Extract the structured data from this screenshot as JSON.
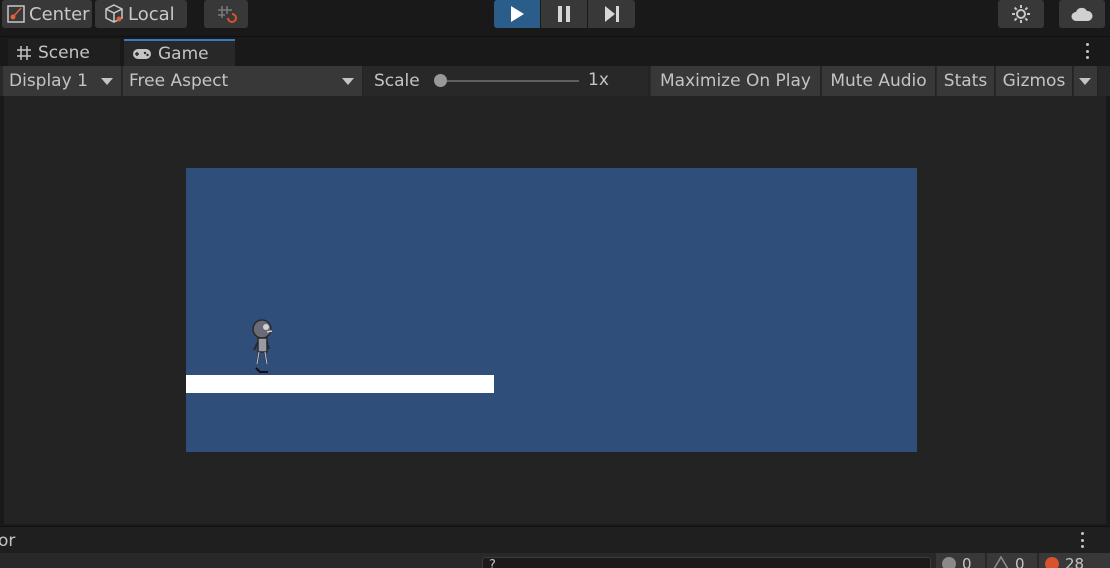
{
  "toolbar": {
    "pivot_label": "Center",
    "space_label": "Local",
    "icons": [
      "center-pivot-icon",
      "local-cube-icon",
      "grid-snap-icon",
      "play-icon",
      "pause-icon",
      "step-icon",
      "settings-sun-icon",
      "cloud-icon"
    ],
    "play_color": "#2b5d8a"
  },
  "tabs": [
    {
      "label": "Scene",
      "icon": "grid-hash-icon",
      "active": false
    },
    {
      "label": "Game",
      "icon": "gamepad-icon",
      "active": true
    }
  ],
  "game_toolbar": {
    "display": "Display 1",
    "aspect": "Free Aspect",
    "scale_label": "Scale",
    "scale_value": "1x",
    "maximize_label": "Maximize On Play",
    "mute_label": "Mute Audio",
    "stats_label": "Stats",
    "gizmos_label": "Gizmos"
  },
  "game_view": {
    "background_color": "#2f4f7a",
    "platform_color": "#ffffff",
    "viewport_color": "#232323"
  },
  "console": {
    "tab_label": "or",
    "search_value": "?",
    "info_count": "0",
    "warning_count": "0",
    "error_count": "28",
    "error_color": "#d8532b"
  }
}
